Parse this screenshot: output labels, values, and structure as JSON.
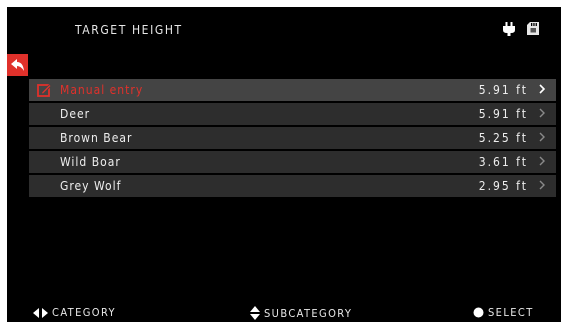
{
  "header": {
    "title": "TARGET HEIGHT",
    "status_icons": [
      "plug-icon",
      "sd-card-icon"
    ]
  },
  "back_button": {
    "icon": "back-arrow-icon"
  },
  "list": {
    "items": [
      {
        "label": "Manual entry",
        "value": "5.91 ft",
        "selected": true,
        "icon": "edit-icon"
      },
      {
        "label": "Deer",
        "value": "5.91 ft"
      },
      {
        "label": "Brown Bear",
        "value": "5.25 ft"
      },
      {
        "label": "Wild Boar",
        "value": "3.61 ft"
      },
      {
        "label": "Grey Wolf",
        "value": "2.95 ft"
      }
    ]
  },
  "footer": {
    "category": "CATEGORY",
    "subcategory": "SUBCATEGORY",
    "select": "SELECT"
  },
  "colors": {
    "accent": "#e0312b",
    "background": "#000000",
    "row": "#2d2d2d",
    "row_selected": "#444444",
    "text": "#eeeeee"
  }
}
